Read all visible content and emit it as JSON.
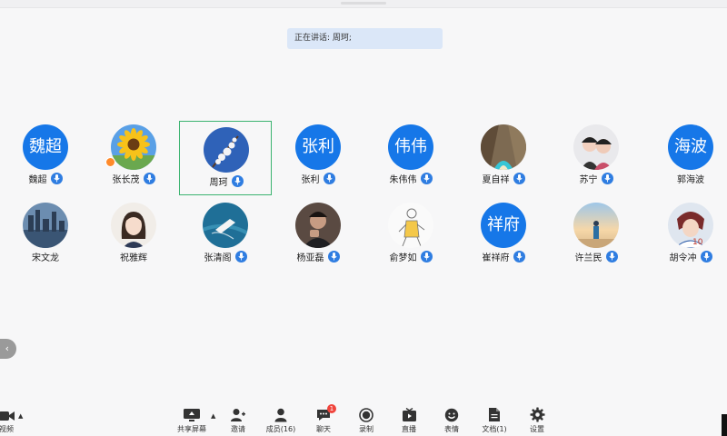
{
  "banner": {
    "text": "正在讲话: 周珂;"
  },
  "participants": [
    {
      "name": "魏超",
      "avatar_text": "魏超",
      "avatar": "name",
      "mic": true,
      "host": false,
      "active": false
    },
    {
      "name": "张长茂",
      "avatar_text": "",
      "avatar": "sunflower",
      "mic": true,
      "host": true,
      "active": false
    },
    {
      "name": "周珂",
      "avatar_text": "",
      "avatar": "blossom",
      "mic": true,
      "host": false,
      "active": true
    },
    {
      "name": "张利",
      "avatar_text": "张利",
      "avatar": "name",
      "mic": true,
      "host": false,
      "active": false
    },
    {
      "name": "朱伟伟",
      "avatar_text": "伟伟",
      "avatar": "name",
      "mic": true,
      "host": false,
      "active": false
    },
    {
      "name": "夏自祥",
      "avatar_text": "",
      "avatar": "beach",
      "mic": true,
      "host": false,
      "active": false
    },
    {
      "name": "苏宁",
      "avatar_text": "",
      "avatar": "couple",
      "mic": true,
      "host": false,
      "active": false
    },
    {
      "name": "郭海波",
      "avatar_text": "海波",
      "avatar": "name",
      "mic": false,
      "host": false,
      "active": false
    },
    {
      "name": "宋文龙",
      "avatar_text": "",
      "avatar": "city",
      "mic": false,
      "host": false,
      "active": false
    },
    {
      "name": "祝雅辉",
      "avatar_text": "",
      "avatar": "girl",
      "mic": false,
      "host": false,
      "active": false
    },
    {
      "name": "张清阁",
      "avatar_text": "",
      "avatar": "boat",
      "mic": true,
      "host": false,
      "active": false
    },
    {
      "name": "杨亚磊",
      "avatar_text": "",
      "avatar": "man",
      "mic": true,
      "host": false,
      "active": false
    },
    {
      "name": "俞梦如",
      "avatar_text": "",
      "avatar": "sketch",
      "mic": true,
      "host": false,
      "active": false
    },
    {
      "name": "崔祥府",
      "avatar_text": "祥府",
      "avatar": "name",
      "mic": true,
      "host": false,
      "active": false
    },
    {
      "name": "许兰民",
      "avatar_text": "",
      "avatar": "sunset",
      "mic": true,
      "host": false,
      "active": false
    },
    {
      "name": "胡令冲",
      "avatar_text": "",
      "avatar": "anime",
      "mic": true,
      "host": false,
      "active": false
    }
  ],
  "left_toggle": {
    "glyph": "‹"
  },
  "toolbar": {
    "video": {
      "label": "视频",
      "icon": "camera-icon"
    },
    "share": {
      "label": "共享屏幕",
      "icon": "screen-share-icon"
    },
    "invite": {
      "label": "邀请",
      "icon": "add-person-icon"
    },
    "members": {
      "label": "成员(16)",
      "icon": "person-icon"
    },
    "chat": {
      "label": "聊天",
      "icon": "chat-icon",
      "badge": "1"
    },
    "record": {
      "label": "录制",
      "icon": "record-icon"
    },
    "live": {
      "label": "直播",
      "icon": "live-icon"
    },
    "reaction": {
      "label": "表情",
      "icon": "smile-icon"
    },
    "docs": {
      "label": "文档(1)",
      "icon": "document-icon"
    },
    "settings": {
      "label": "设置",
      "icon": "gear-icon"
    },
    "caret": "▲"
  },
  "colors": {
    "accent": "#1677e8",
    "mic": "#2f7de1",
    "active_border": "#3cb371",
    "banner_bg": "#dbe7f8"
  }
}
